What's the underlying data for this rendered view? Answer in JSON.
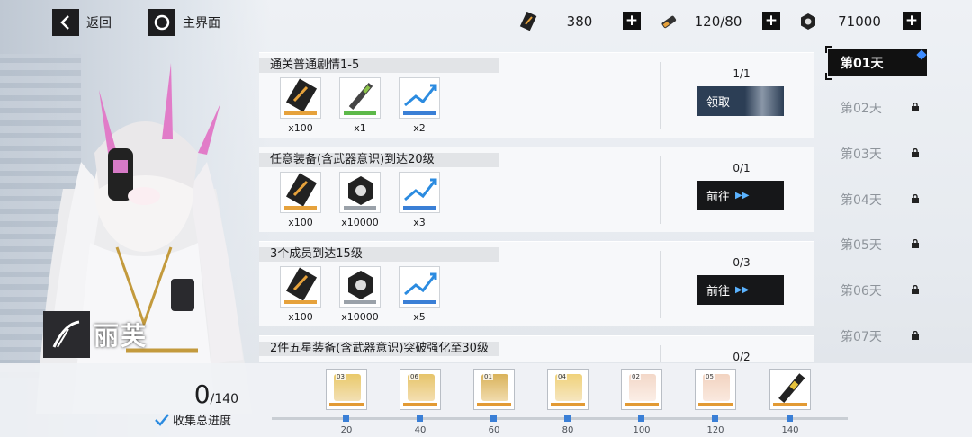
{
  "topbar": {
    "back_label": "返回",
    "home_label": "主界面"
  },
  "resources": [
    {
      "icon": "ticket-icon",
      "value": "380"
    },
    {
      "icon": "battery-icon",
      "value": "120/80"
    },
    {
      "icon": "coin-icon",
      "value": "71000"
    }
  ],
  "character": {
    "name": "丽芙"
  },
  "tasks": [
    {
      "title": "通关普通剧情1-5",
      "progress": "1/1",
      "action": "领取",
      "rewards": [
        {
          "icon": "supply-ticket-icon",
          "qty": "x100"
        },
        {
          "icon": "supply-stick-icon",
          "qty": "x1"
        },
        {
          "icon": "exp-arrow-icon",
          "qty": "x2"
        }
      ]
    },
    {
      "title": "任意装备(含武器意识)到达20级",
      "progress": "0/1",
      "action": "前往",
      "rewards": [
        {
          "icon": "supply-ticket-icon",
          "qty": "x100"
        },
        {
          "icon": "coin-icon",
          "qty": "x10000"
        },
        {
          "icon": "exp-arrow-icon",
          "qty": "x3"
        }
      ]
    },
    {
      "title": "3个成员到达15级",
      "progress": "0/3",
      "action": "前往",
      "rewards": [
        {
          "icon": "supply-ticket-icon",
          "qty": "x100"
        },
        {
          "icon": "coin-icon",
          "qty": "x10000"
        },
        {
          "icon": "exp-arrow-icon",
          "qty": "x5"
        }
      ]
    },
    {
      "title": "2件五星装备(含武器意识)突破强化至30级",
      "progress": "0/2",
      "action": "",
      "rewards": []
    }
  ],
  "days": [
    {
      "label": "第01天",
      "active": true,
      "locked": false
    },
    {
      "label": "第02天",
      "active": false,
      "locked": true
    },
    {
      "label": "第03天",
      "active": false,
      "locked": true
    },
    {
      "label": "第04天",
      "active": false,
      "locked": true
    },
    {
      "label": "第05天",
      "active": false,
      "locked": true
    },
    {
      "label": "第06天",
      "active": false,
      "locked": true
    },
    {
      "label": "第07天",
      "active": false,
      "locked": true
    }
  ],
  "collection": {
    "current": "0",
    "total": "/140",
    "label": "收集总进度"
  },
  "milestones": [
    {
      "value": "20",
      "badge": "03"
    },
    {
      "value": "40",
      "badge": "06"
    },
    {
      "value": "60",
      "badge": "01"
    },
    {
      "value": "80",
      "badge": "04"
    },
    {
      "value": "100",
      "badge": "02"
    },
    {
      "value": "120",
      "badge": "05"
    },
    {
      "value": "140",
      "badge": ""
    }
  ]
}
